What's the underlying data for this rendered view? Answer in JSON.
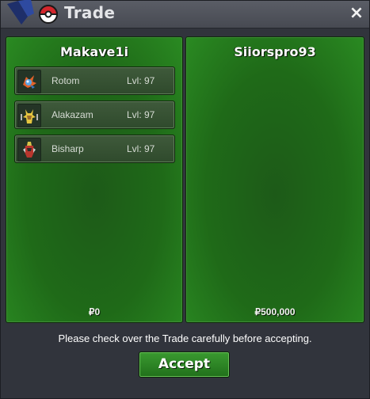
{
  "window": {
    "title": "Trade",
    "close_icon": "×"
  },
  "left_panel": {
    "player_name": "Makave1i",
    "money": "₽0",
    "pokemon": [
      {
        "name": "Rotom",
        "level": "Lvl: 97",
        "icon": "rotom-sprite-icon"
      },
      {
        "name": "Alakazam",
        "level": "Lvl: 97",
        "icon": "alakazam-sprite-icon"
      },
      {
        "name": "Bisharp",
        "level": "Lvl: 97",
        "icon": "bisharp-sprite-icon"
      }
    ]
  },
  "right_panel": {
    "player_name": "Siiorspro93",
    "money": "₽500,000",
    "pokemon": []
  },
  "footer": {
    "notice": "Please check over the Trade carefully before accepting.",
    "accept_label": "Accept"
  },
  "colors": {
    "panel_green": "#1f6a18",
    "accept_green": "#2d8a25",
    "titlebar": "#50535b"
  }
}
